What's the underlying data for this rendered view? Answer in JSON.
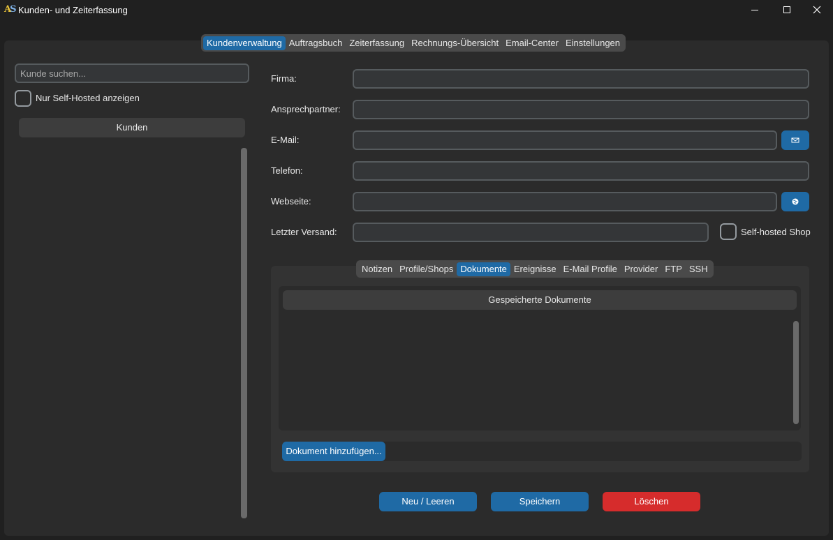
{
  "window": {
    "title": "Kunden- und Zeiterfassung",
    "icon_text": "A",
    "icon_text2": "S"
  },
  "top_tabs": [
    {
      "label": "Kundenverwaltung",
      "active": true
    },
    {
      "label": "Auftragsbuch",
      "active": false
    },
    {
      "label": "Zeiterfassung",
      "active": false
    },
    {
      "label": "Rechnungs-Übersicht",
      "active": false
    },
    {
      "label": "Email-Center",
      "active": false
    },
    {
      "label": "Einstellungen",
      "active": false
    }
  ],
  "sidebar": {
    "search_placeholder": "Kunde suchen...",
    "self_hosted_filter_label": "Nur Self-Hosted anzeigen",
    "list_header": "Kunden"
  },
  "form": {
    "firma_label": "Firma:",
    "ansprechpartner_label": "Ansprechpartner:",
    "email_label": "E-Mail:",
    "telefon_label": "Telefon:",
    "webseite_label": "Webseite:",
    "letzter_versand_label": "Letzter Versand:",
    "self_hosted_label": "Self-hosted Shop",
    "email_button_icon": "envelope-icon",
    "web_button_icon": "globe-icon"
  },
  "sub_tabs": [
    {
      "label": "Notizen",
      "active": false
    },
    {
      "label": "Profile/Shops",
      "active": false
    },
    {
      "label": "Dokumente",
      "active": true
    },
    {
      "label": "Ereignisse",
      "active": false
    },
    {
      "label": "E-Mail Profile",
      "active": false
    },
    {
      "label": "Provider",
      "active": false
    },
    {
      "label": "FTP",
      "active": false
    },
    {
      "label": "SSH",
      "active": false
    }
  ],
  "documents": {
    "header": "Gespeicherte Dokumente",
    "add_button": "Dokument hinzufügen..."
  },
  "actions": {
    "new_label": "Neu / Leeren",
    "save_label": "Speichern",
    "delete_label": "Löschen"
  },
  "colors": {
    "accent": "#1f6aa5",
    "danger": "#d62c2c",
    "background": "#202020",
    "panel": "#2b2b2b"
  }
}
